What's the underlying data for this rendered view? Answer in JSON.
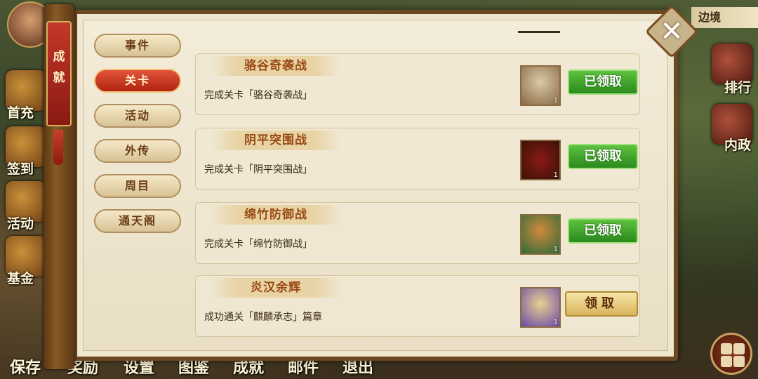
{
  "left_hud": {
    "items": [
      {
        "label": "首充"
      },
      {
        "label": "签到"
      },
      {
        "label": "活动"
      },
      {
        "label": "基金"
      }
    ]
  },
  "bottom_menu": [
    "保存",
    "奖励",
    "设置",
    "图鉴",
    "成就",
    "邮件",
    "退出"
  ],
  "right_hud": {
    "title": "边境",
    "items": [
      {
        "label": "排行"
      },
      {
        "label": "内政"
      }
    ]
  },
  "panel": {
    "scroll_label": [
      "成",
      "就"
    ],
    "close_icon": "close-icon"
  },
  "tabs": [
    {
      "label": "事件",
      "active": false
    },
    {
      "label": "关卡",
      "active": true
    },
    {
      "label": "活动",
      "active": false
    },
    {
      "label": "外传",
      "active": false
    },
    {
      "label": "周目",
      "active": false
    },
    {
      "label": "通天阁",
      "active": false
    }
  ],
  "achievements": [
    {
      "title": "骆谷奇袭战",
      "desc": "完成关卡「骆谷奇袭战」",
      "reward_icon": "vase-icon",
      "qty": "1",
      "status": "已领取"
    },
    {
      "title": "阴平突围战",
      "desc": "完成关卡「阴平突围战」",
      "reward_icon": "chest-icon",
      "qty": "1",
      "status": "已领取"
    },
    {
      "title": "绵竹防御战",
      "desc": "完成关卡「绵竹防御战」",
      "reward_icon": "drum-icon",
      "qty": "1",
      "status": "已领取"
    },
    {
      "title": "炎汉余辉",
      "desc": "成功通关「麒麟承志」篇章",
      "reward_icon": "book-icon",
      "qty": "1",
      "status": "领取"
    }
  ]
}
